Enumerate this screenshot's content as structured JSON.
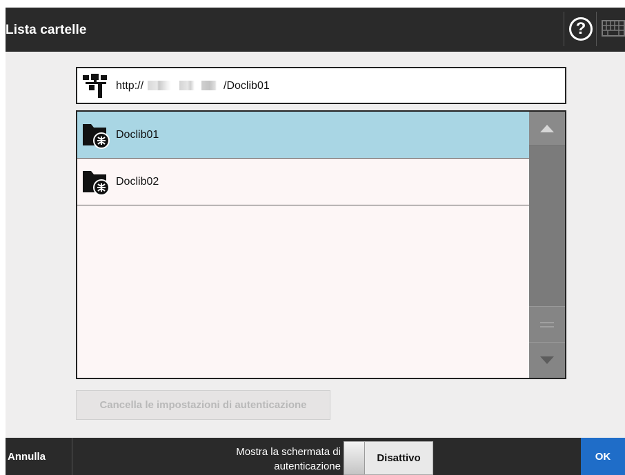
{
  "header": {
    "title": "Lista cartelle",
    "help_glyph": "?",
    "help_icon": "help-circle-icon",
    "keyboard_icon": "keyboard-icon"
  },
  "path_bar": {
    "icon": "network-icon",
    "prefix": "http://",
    "suffix": "/Doclib01"
  },
  "folder_list": {
    "items": [
      {
        "label": "Doclib01",
        "icon": "web-folder-icon",
        "selected": true
      },
      {
        "label": "Doclib02",
        "icon": "web-folder-icon",
        "selected": false
      }
    ],
    "scroll_up_icon": "scroll-up-arrow-icon",
    "scroll_grip_icon": "scroll-grip-icon",
    "scroll_down_icon": "scroll-down-arrow-icon"
  },
  "clear_auth_button": {
    "label": "Cancella le impostazioni di autenticazione",
    "enabled": false
  },
  "footer": {
    "cancel_label": "Annulla",
    "auth_screen_label": "Mostra la schermata di autenticazione",
    "toggle_state": "Disattivo",
    "ok_label": "OK"
  },
  "colors": {
    "header_bg": "#2a2a2a",
    "selected_row": "#a9d6e4",
    "ok_button": "#1f6dc8",
    "screen_bg": "#efeeee"
  }
}
